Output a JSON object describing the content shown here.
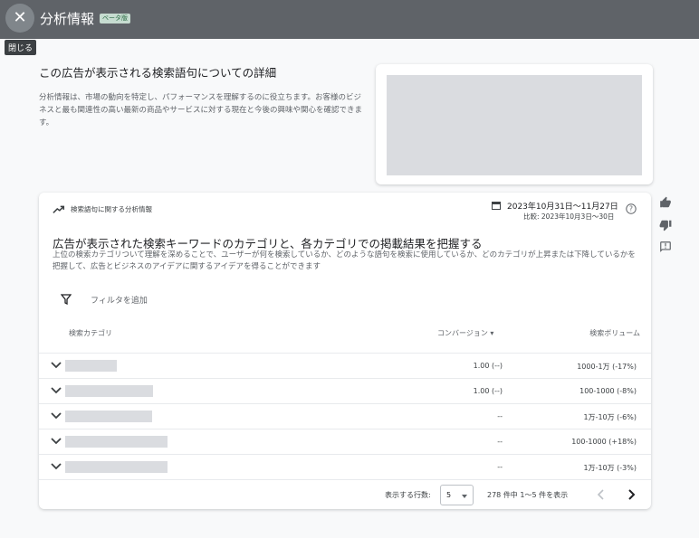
{
  "topbar": {
    "close_icon": "close-icon",
    "title": "分析情報",
    "beta": "ベータ版",
    "close_tooltip": "閉じる"
  },
  "intro": {
    "title": "この広告が表示される検索語句についての詳細",
    "description": "分析情報は、市場の動向を特定し、パフォーマンスを理解するのに役立ちます。お客様のビジネスと最も関連性の高い最新の商品やサービスに対する現在と今後の興味や関心を確認できます。"
  },
  "feedback": {
    "icons": [
      "thumb-up-icon",
      "thumb-down-icon",
      "report-icon"
    ]
  },
  "card": {
    "header_label": "検索語句に関する分析情報",
    "date_range": "2023年10月31日～11月27日",
    "compare_range": "比較: 2023年10月3日～30日",
    "title": "広告が表示された検索キーワードのカテゴリと、各カテゴリでの掲載結果を把握する",
    "description": "上位の検索カテゴリついて理解を深めることで、ユーザーが何を検索しているか、どのような語句を検索に使用しているか、どのカテゴリが上昇または下降しているかを把握して、広告とビジネスのアイデアに関するアイデアを得ることができます",
    "filter_label": "フィルタを追加",
    "columns": {
      "category": "検索カテゴリ",
      "conversion": "コンバージョン ▾",
      "volume": "検索ボリューム"
    },
    "rows": [
      {
        "conversion": "1.00 (--)",
        "volume": "1000-1万 (-17%)"
      },
      {
        "conversion": "1.00 (--)",
        "volume": "100-1000 (-8%)"
      },
      {
        "conversion": "--",
        "volume": "1万-10万 (-6%)"
      },
      {
        "conversion": "--",
        "volume": "100-1000 (+18%)"
      },
      {
        "conversion": "--",
        "volume": "1万-10万 (-3%)"
      }
    ],
    "footer": {
      "rows_label": "表示する行数:",
      "rows_value": "5",
      "range_label": "278 件中 1～5 件を表示"
    }
  },
  "colors": {
    "topbar": "#5f6368",
    "background": "#f8f9fa",
    "placeholder": "#dadce0"
  }
}
